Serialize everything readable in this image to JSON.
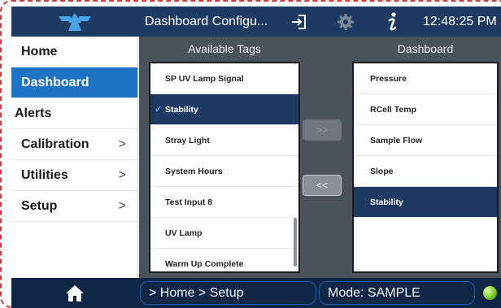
{
  "title_bar": {
    "logo": "teledyne-logo",
    "title": "Dashboard Configu...",
    "icons": [
      "exit-icon",
      "gear-icon",
      "info-icon"
    ],
    "clock": "12:48:25 PM"
  },
  "sidebar": {
    "items": [
      {
        "label": "Home",
        "chevron": ""
      },
      {
        "label": "Dashboard",
        "chevron": ""
      },
      {
        "label": "Alerts",
        "chevron": ""
      },
      {
        "label": "Calibration",
        "chevron": ">"
      },
      {
        "label": "Utilities",
        "chevron": ">"
      },
      {
        "label": "Setup",
        "chevron": ">"
      }
    ],
    "active_index": 1
  },
  "available_tags": {
    "header": "Available Tags",
    "items": [
      "SP UV Lamp Signal",
      "Stability",
      "Stray Light",
      "System Hours",
      "Test Input 8",
      "UV Lamp",
      "Warm Up Complete"
    ],
    "selected": "Stability",
    "check_mark": "✓"
  },
  "dashboard": {
    "header": "Dashboard",
    "items": [
      "Pressure",
      "RCell Temp",
      "Sample Flow",
      "Slope",
      "Stability"
    ],
    "selected": "Stability"
  },
  "buttons": {
    "add": ">>",
    "remove": "<<"
  },
  "status_bar": {
    "breadcrumb": "> Home > Setup",
    "mode": "Mode: SAMPLE",
    "status_color": "#7ecb24"
  },
  "colors": {
    "title_bar": "#1d3a62",
    "bottom_bar": "#0f2646",
    "accent": "#1f73c6",
    "selection": "#1d3a62",
    "panel": "#4a525c"
  }
}
